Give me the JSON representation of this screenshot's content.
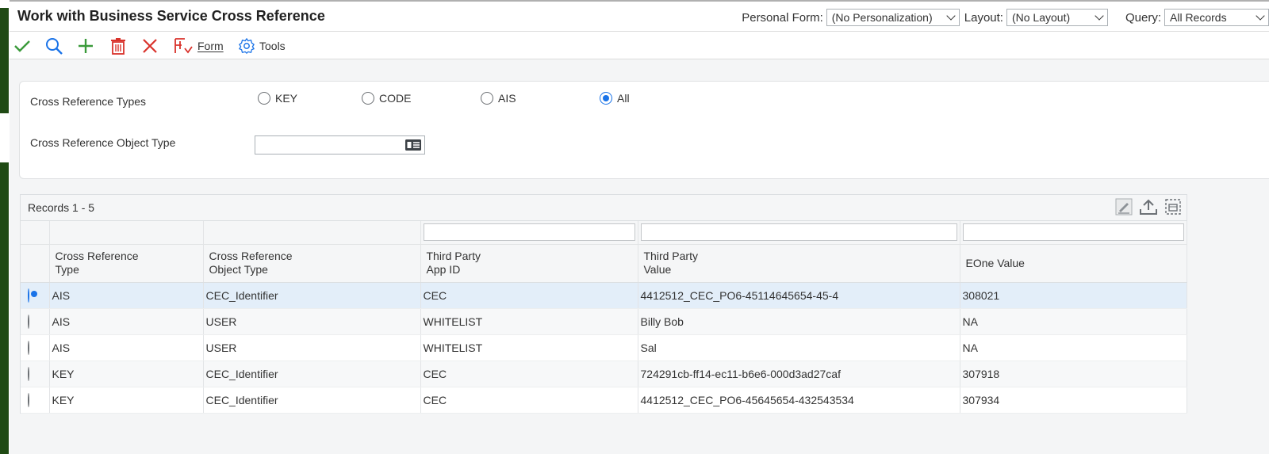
{
  "title": "Work with Business Service Cross Reference",
  "header": {
    "personal_form_label": "Personal Form:",
    "personal_form_value": "(No Personalization)",
    "layout_label": "Layout:",
    "layout_value": "(No Layout)",
    "query_label": "Query:",
    "query_value": "All Records"
  },
  "toolbar": {
    "form_label": "Form",
    "tools_label": "Tools",
    "icons": [
      "checkmark-icon",
      "search-icon",
      "add-icon",
      "trash-icon",
      "close-icon",
      "form-menu-icon",
      "gear-icon"
    ]
  },
  "filters": {
    "types_label": "Cross Reference Types",
    "options": [
      {
        "label": "KEY",
        "selected": false
      },
      {
        "label": "CODE",
        "selected": false
      },
      {
        "label": "AIS",
        "selected": false
      },
      {
        "label": "All",
        "selected": true
      }
    ],
    "object_type_label": "Cross Reference Object Type",
    "object_type_value": ""
  },
  "grid": {
    "records_label": "Records 1 - 5",
    "columns": [
      [
        "Cross Reference",
        "Type"
      ],
      [
        "Cross Reference",
        "Object Type"
      ],
      [
        "Third Party",
        "App ID"
      ],
      [
        "Third Party",
        "Value"
      ],
      [
        "EOne Value"
      ]
    ],
    "rows": [
      {
        "selected": true,
        "cells": [
          "AIS",
          "CEC_Identifier",
          "CEC",
          "4412512_CEC_PO6-45114645654-45-4",
          "308021"
        ]
      },
      {
        "selected": false,
        "cells": [
          "AIS",
          "USER",
          "WHITELIST",
          "Billy Bob",
          "NA"
        ]
      },
      {
        "selected": false,
        "cells": [
          "AIS",
          "USER",
          "WHITELIST",
          "Sal",
          "NA"
        ]
      },
      {
        "selected": false,
        "cells": [
          "KEY",
          "CEC_Identifier",
          "CEC",
          "724291cb-ff14-ec11-b6e6-000d3ad27caf",
          "307918"
        ]
      },
      {
        "selected": false,
        "cells": [
          "KEY",
          "CEC_Identifier",
          "CEC",
          "4412512_CEC_PO6-45645654-432543534",
          "307934"
        ]
      }
    ]
  },
  "colors": {
    "accent": "#1a73e8",
    "ok_green": "#3a9a3a",
    "danger_red": "#d9322b",
    "sidebar_green": "#1f4a14"
  }
}
